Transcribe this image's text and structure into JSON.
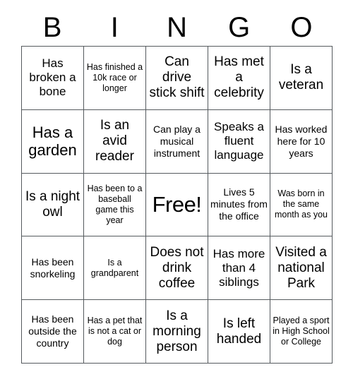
{
  "card": {
    "title_letters": [
      "B",
      "I",
      "N",
      "G",
      "O"
    ],
    "colors": {
      "background": "#ffffff",
      "text": "#000000",
      "grid_line": "#555a5e"
    },
    "grid_size": "5x5",
    "rows": [
      [
        {
          "text": "Has broken a bone",
          "size": "sm"
        },
        {
          "text": "Has finished a 10k race or longer",
          "size": "xxs"
        },
        {
          "text": "Can drive stick shift",
          "size": "md"
        },
        {
          "text": "Has met a celebrity",
          "size": "md"
        },
        {
          "text": "Is a veteran",
          "size": "md"
        }
      ],
      [
        {
          "text": "Has a garden",
          "size": "lg"
        },
        {
          "text": "Is an avid reader",
          "size": "md"
        },
        {
          "text": "Can play a musical instrument",
          "size": "xs"
        },
        {
          "text": "Speaks a fluent language",
          "size": "sm"
        },
        {
          "text": "Has worked here for 10 years",
          "size": "xs"
        }
      ],
      [
        {
          "text": "Is a night owl",
          "size": "md"
        },
        {
          "text": "Has been to a baseball game this year",
          "size": "xxs"
        },
        {
          "text": "Free!",
          "size": "xl"
        },
        {
          "text": "Lives 5 minutes from the office",
          "size": "xs"
        },
        {
          "text": "Was born in the same month as you",
          "size": "xxs"
        }
      ],
      [
        {
          "text": "Has been snorkeling",
          "size": "xs"
        },
        {
          "text": "Is a grandparent",
          "size": "xxs"
        },
        {
          "text": "Does not drink coffee",
          "size": "md"
        },
        {
          "text": "Has more than 4 siblings",
          "size": "sm"
        },
        {
          "text": "Visited a national Park",
          "size": "md"
        }
      ],
      [
        {
          "text": "Has been outside the country",
          "size": "xs"
        },
        {
          "text": "Has a pet that is not a cat or dog",
          "size": "xxs"
        },
        {
          "text": "Is a morning person",
          "size": "md"
        },
        {
          "text": "Is left handed",
          "size": "md"
        },
        {
          "text": "Played a sport in High School or College",
          "size": "xxs"
        }
      ]
    ]
  }
}
